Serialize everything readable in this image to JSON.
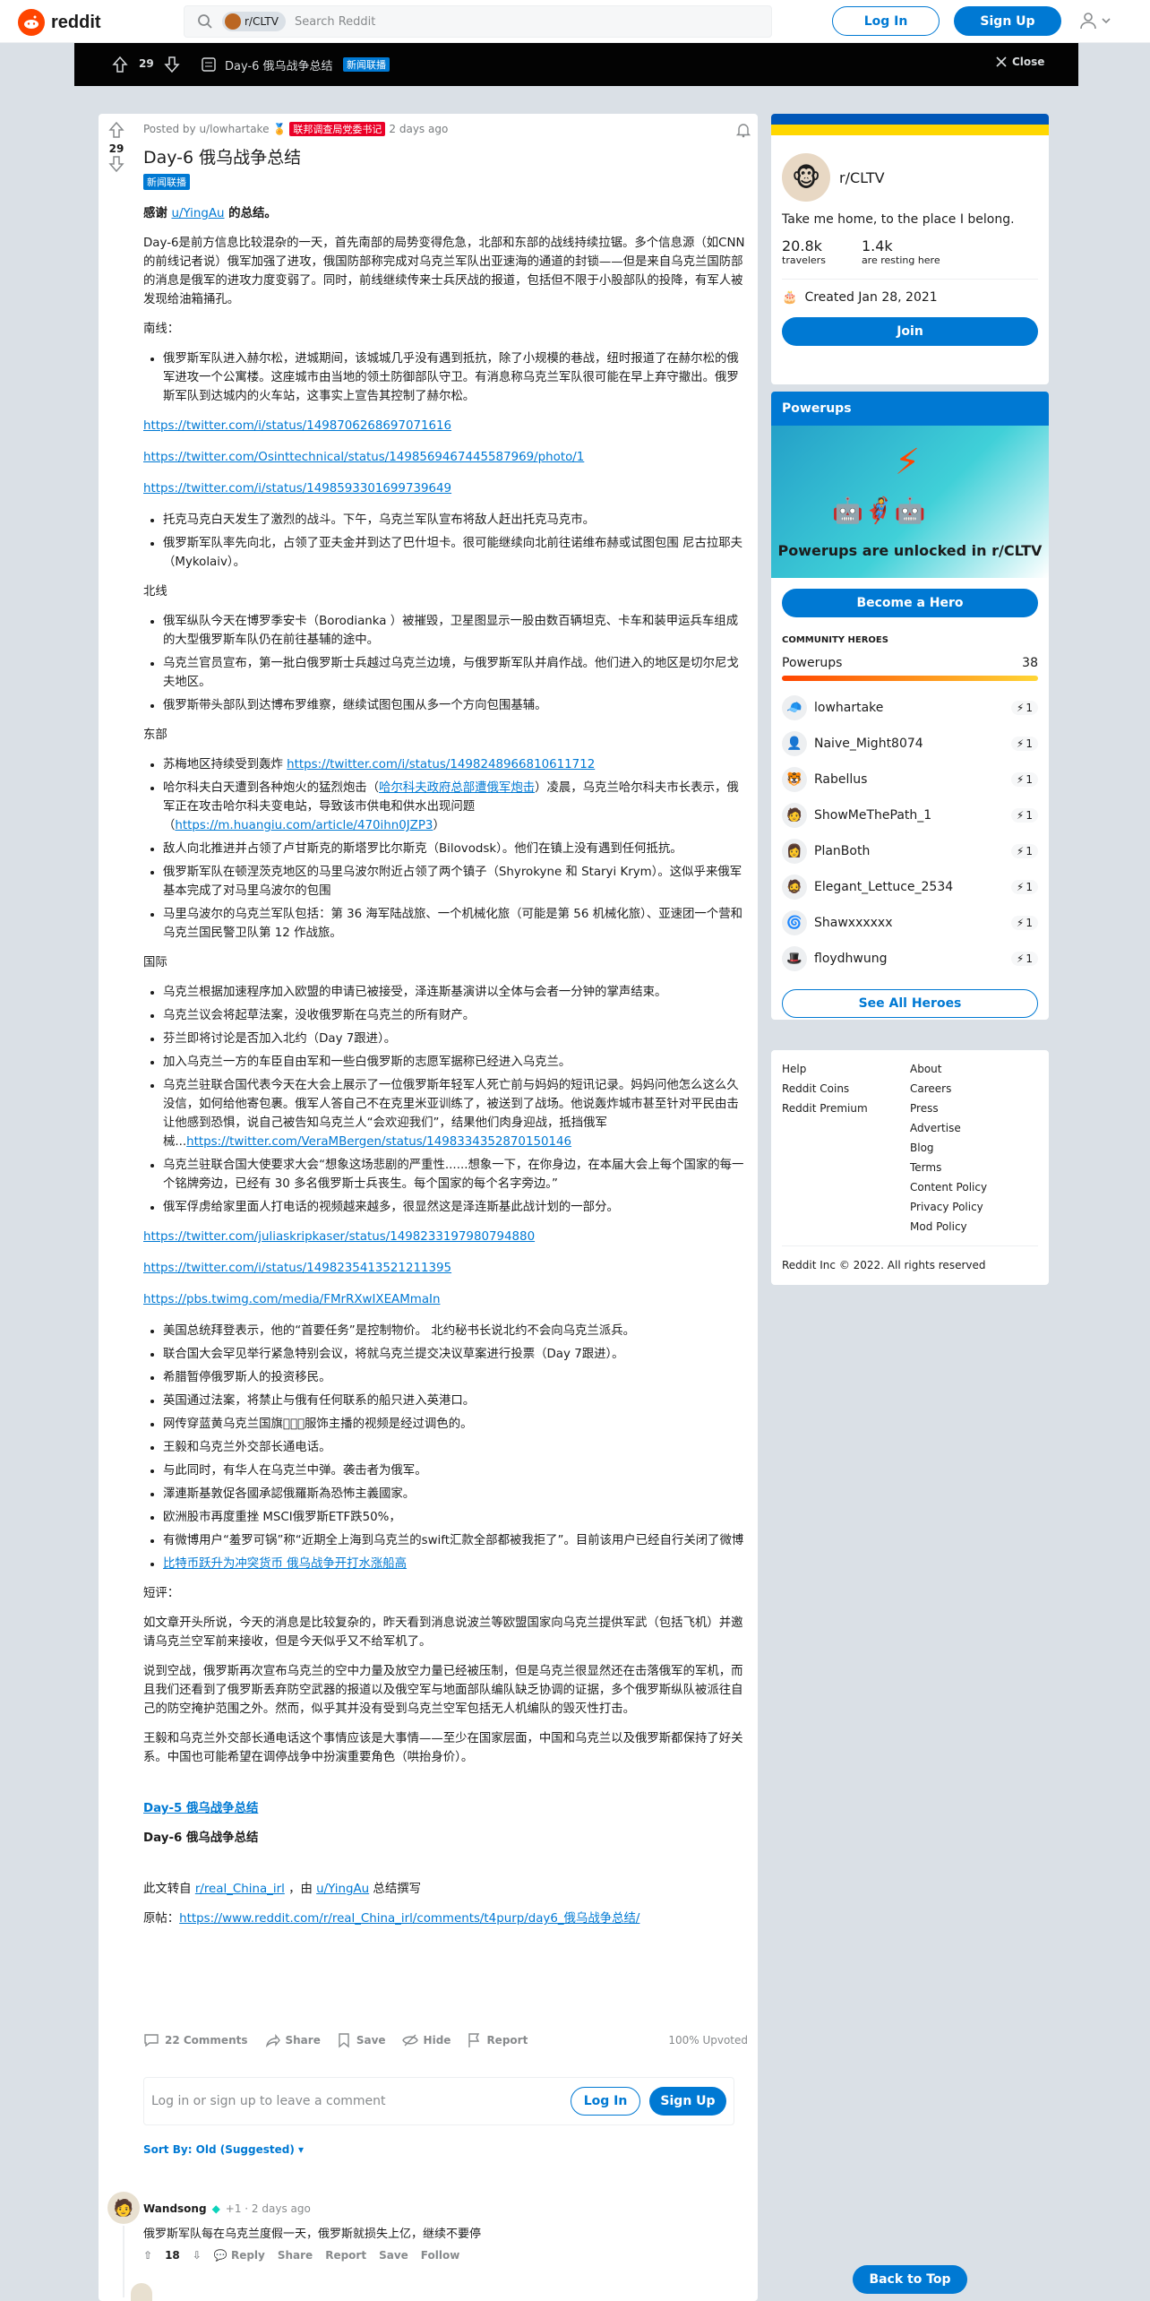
{
  "header": {
    "logo_text": "reddit",
    "search_chip": "r/CLTV",
    "search_placeholder": "Search Reddit",
    "login": "Log In",
    "signup": "Sign Up"
  },
  "darkbar": {
    "votes": "29",
    "title": "Day-6 俄乌战争总结",
    "flair": "新闻联播",
    "close": "Close"
  },
  "post": {
    "votes": "29",
    "posted_by": "Posted by u/lowhartake",
    "user_flair": "联邦调查局党委书记",
    "time": "2 days ago",
    "title": "Day-6 俄乌战争总结",
    "flair": "新闻联播",
    "thanks_prefix": "感谢 ",
    "thanks_link": "u/YingAu",
    "thanks_suffix": " 的总结。",
    "intro": "Day-6是前方信息比较混杂的一天，首先南部的局势变得危急，北部和东部的战线持续拉锯。多个信息源（如CNN的前线记者说）俄军加强了进攻，俄国防部称完成对乌克兰军队出亚速海的通道的封锁——但是来自乌克兰国防部的消息是俄军的进攻力度变弱了。同时，前线继续传来士兵厌战的报道，包括但不限于小股部队的投降，有军人被发现给油箱捅孔。",
    "south_h": "南线：",
    "south_1": "俄罗斯军队进入赫尔松，进城期间，该城城几乎没有遇到抵抗，除了小规模的巷战，纽时报道了在赫尔松的俄军进攻一个公寓楼。这座城市由当地的领土防御部队守卫。有消息称乌克兰军队很可能在早上弃守撤出。俄罗斯军队到达城内的火车站，这事实上宣告其控制了赫尔松。",
    "link_1": "https://twitter.com/i/status/1498706268697071616",
    "link_2": "https://twitter.com/Osinttechnical/status/1498569467445587969/photo/1",
    "link_3": "https://twitter.com/i/status/1498593301699739649",
    "south_2": "托克马克白天发生了激烈的战斗。下午，乌克兰军队宣布将敌人赶出托克马克市。",
    "south_3": "俄罗斯军队率先向北，占领了亚夫金并到达了巴什坦卡。很可能继续向北前往诺维布赫或试图包围 尼古拉耶夫（Mykolaiv）。",
    "north_h": "北线",
    "north_1": "俄军纵队今天在博罗季安卡（Borodianka ）被摧毁，卫星图显示一股由数百辆坦克、卡车和装甲运兵车组成的大型俄罗斯车队仍在前往基辅的途中。",
    "north_2": "乌克兰官员宣布，第一批白俄罗斯士兵越过乌克兰边境，与俄罗斯军队并肩作战。他们进入的地区是切尔尼戈夫地区。",
    "north_3": "俄罗斯带头部队到达博布罗维察，继续试图包围从多一个方向包围基辅。",
    "east_h": "东部",
    "east_1_pre": "苏梅地区持续受到轰炸 ",
    "east_1_link": "https://twitter.com/i/status/1498248966810611712",
    "east_2_pre": "哈尔科夫白天遭到各种炮火的猛烈炮击（",
    "east_2_link": "哈尔科夫政府总部遭俄军炮击",
    "east_2_mid": "）凌晨，乌克兰哈尔科夫市长表示，俄军正在攻击哈尔科夫变电站，导致该市供电和供水出现问题（",
    "east_2_link2": "https://m.huangiu.com/article/470ihn0JZP3",
    "east_2_end": "）",
    "east_3": "敌人向北推进并占领了卢甘斯克的斯塔罗比尔斯克（Bilovodsk）。他们在镇上没有遇到任何抵抗。",
    "east_4": "俄罗斯军队在顿涅茨克地区的马里乌波尔附近占领了两个镇子（Shyrokyne 和 Staryi Krym）。这似乎来俄军基本完成了对马里乌波尔的包围",
    "east_5": "马里乌波尔的乌克兰军队包括：第 36 海军陆战旅、一个机械化旅（可能是第 56 机械化旅）、亚速团一个营和乌克兰国民警卫队第 12 作战旅。",
    "intl_h": "国际",
    "intl_1": "乌克兰根据加速程序加入欧盟的申请已被接受，泽连斯基演讲以全体与会者一分钟的掌声结束。",
    "intl_2": "乌克兰议会将起草法案，没收俄罗斯在乌克兰的所有财产。",
    "intl_3": "芬兰即将讨论是否加入北约（Day 7跟进）。",
    "intl_4": "加入乌克兰一方的车臣自由军和一些白俄罗斯的志愿军据称已经进入乌克兰。",
    "intl_5": "乌克兰驻联合国代表今天在大会上展示了一位俄罗斯年轻军人死亡前与妈妈的短讯记录。妈妈问他怎么这么久没信，如何给他寄包裹。俄军人答自己不在克里米亚训练了，被送到了战场。他说轰炸城市甚至针对平民由击让他感到恐惧，说自己被告知乌克兰人“会欢迎我们”，结果他们肉身迎战，抵挡俄军械...",
    "intl_5_link": "https://twitter.com/VeraMBergen/status/1498334352870150146",
    "intl_6": "乌克兰驻联合国大使要求大会“想象这场悲剧的严重性......想象一下，在你身边，在本届大会上每个国家的每一个铭牌旁边，已经有 30 多名俄罗斯士兵丧生。每个国家的每个名字旁边。”",
    "intl_7": "俄军俘虏给家里面人打电话的视频越来越多，很显然这是泽连斯基此战计划的一部分。",
    "link_4": "https://twitter.com/juliaskripkaser/status/1498233197980794880",
    "link_5": "https://twitter.com/i/status/1498235413521211395",
    "link_6": "https://pbs.twimg.com/media/FMrRXwIXEAMmaIn",
    "misc_1": "美国总统拜登表示，他的“首要任务”是控制物价。 北约秘书长说北约不会向乌克兰派兵。",
    "misc_2": "联合国大会罕见举行紧急特别会议，将就乌克兰提交决议草案进行投票（Day 7跟进）。",
    "misc_3": "希腊暂停俄罗斯人的投资移民。",
    "misc_4": "英国通过法案，将禁止与俄有任何联系的船只进入英港口。",
    "misc_5": "网传穿蓝黄乌克兰国旗色⃣⃣服饰主播的视频是经过调色的。",
    "misc_6": "王毅和乌克兰外交部长通电话。",
    "misc_7": "与此同时，有华人在乌克兰中弹。袭击者为俄军。",
    "misc_8": "澤連斯基敦促各國承認俄羅斯為恐怖主義國家。",
    "misc_9": "欧洲股市再度重挫 MSCI俄罗斯ETF跌50%，",
    "misc_10": "有微博用户“羞罗可锅”称“近期全上海到乌克兰的swift汇款全部都被我拒了”。目前该用户已经自行关闭了微博",
    "misc_11_link": "比特币跃升为冲突货币 俄乌战争开打水涨船高",
    "review_h": "短评：",
    "review_1": "如文章开头所说，今天的消息是比较复杂的，昨天看到消息说波兰等欧盟国家向乌克兰提供军武（包括飞机）并邀请乌克兰空军前来接收，但是今天似乎又不给军机了。",
    "review_2": "说到空战，俄罗斯再次宣布乌克兰的空中力量及放空力量已经被压制，但是乌克兰很显然还在击落俄军的军机，而且我们还看到了俄罗斯丢弃防空武器的报道以及俄空军与地面部队编队缺乏协调的证据，多个俄罗斯纵队被派往自己的防空掩护范围之外。然而，似乎其并没有受到乌克兰空军包括无人机编队的毁灭性打击。",
    "review_3": "王毅和乌克兰外交部长通电话这个事情应该是大事情——至少在国家层面，中国和乌克兰以及俄罗斯都保持了好关系。中国也可能希望在调停战争中扮演重要角色（哄抬身价）。",
    "day5_link": "Day-5 俄乌战争总结",
    "day6_bold": "Day-6 俄乌战争总结",
    "repost_pre": "此文转自 ",
    "repost_link1": "r/real_China_irl",
    "repost_mid": " ，由 ",
    "repost_link2": "u/YingAu",
    "repost_suf": " 总结撰写",
    "orig_pre": "原帖：",
    "orig_link": "https://www.reddit.com/r/real_China_irl/comments/t4purp/day6_俄乌战争总结/"
  },
  "actions": {
    "comments": "22 Comments",
    "share": "Share",
    "save": "Save",
    "hide": "Hide",
    "report": "Report",
    "upvoted": "100% Upvoted"
  },
  "comment_box": {
    "placeholder": "Log in or sign up to leave a comment",
    "login": "Log In",
    "signup": "Sign Up"
  },
  "sort": "Sort By: Old (Suggested)",
  "comments": [
    {
      "user": "Wandsong",
      "score_meta": "+1 · 2 days ago",
      "text": "俄罗斯军队每在乌克兰度假一天，俄罗斯就损失上亿，继续不要停",
      "votes": "18",
      "reply": "Reply",
      "share": "Share",
      "report": "Report",
      "save": "Save",
      "follow": "Follow"
    }
  ],
  "sidebar": {
    "community_name": "r/CLTV",
    "tagline": "Take me home, to the place I belong.",
    "members": "20.8k",
    "members_label": "travelers",
    "online": "1.4k",
    "online_label": "are resting here",
    "created": "Created Jan 28, 2021",
    "join": "Join",
    "powerups_h": "Powerups",
    "powerups_unlocked": "Powerups are unlocked in r/CLTV",
    "become_hero": "Become a Hero",
    "heroes_h": "COMMUNITY HEROES",
    "powerups_label": "Powerups",
    "powerups_count": "38",
    "heroes": [
      {
        "name": "lowhartake",
        "n": "1"
      },
      {
        "name": "Naive_Might8074",
        "n": "1"
      },
      {
        "name": "Rabellus",
        "n": "1"
      },
      {
        "name": "ShowMeThePath_1",
        "n": "1"
      },
      {
        "name": "PlanBoth",
        "n": "1"
      },
      {
        "name": "Elegant_Lettuce_2534",
        "n": "1"
      },
      {
        "name": "Shawxxxxxx",
        "n": "1"
      },
      {
        "name": "floydhwung",
        "n": "1"
      }
    ],
    "see_all": "See All Heroes",
    "footer_left": [
      "Help",
      "Reddit Coins",
      "Reddit Premium"
    ],
    "footer_right": [
      "About",
      "Careers",
      "Press",
      "Advertise",
      "Blog",
      "Terms",
      "Content Policy",
      "Privacy Policy",
      "Mod Policy"
    ],
    "copyright": "Reddit Inc © 2022. All rights reserved"
  },
  "back_to_top": "Back to Top"
}
